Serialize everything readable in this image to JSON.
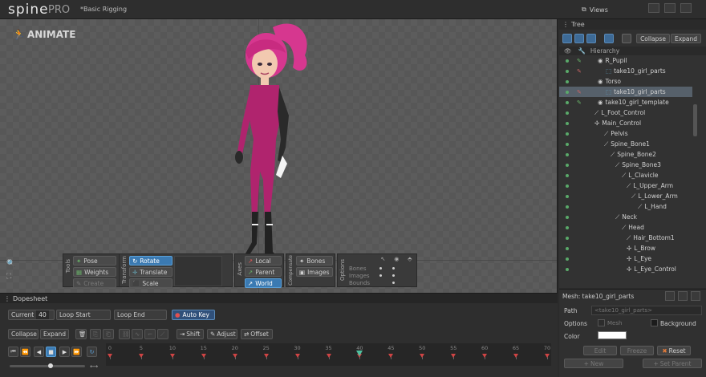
{
  "app": {
    "logo": "spine",
    "edition": "PRO",
    "project_title": "*Basic Rigging",
    "views_label": "Views"
  },
  "viewport": {
    "mode_label": "ANIMATE"
  },
  "tools": {
    "tools_group": "Tools",
    "pose": "Pose",
    "weights": "Weights",
    "create": "Create",
    "transform_group": "Transform",
    "rotate": "Rotate",
    "translate": "Translate",
    "scale": "Scale",
    "axes_group": "Axes",
    "local": "Local",
    "parent": "Parent",
    "world": "World",
    "compensate_group": "Compensate",
    "bones": "Bones",
    "images": "Images",
    "options_group": "Options",
    "opt_bones": "Bones",
    "opt_images": "Images",
    "opt_bounds": "Bounds"
  },
  "tree": {
    "tab_label": "Tree",
    "collapse": "Collapse",
    "expand": "Expand",
    "hierarchy": "Hierarchy",
    "rows": [
      {
        "label": "R_Pupil"
      },
      {
        "label": "take10_girl_parts"
      },
      {
        "label": "Torso"
      },
      {
        "label": "take10_girl_parts"
      },
      {
        "label": "take10_girl_template"
      },
      {
        "label": "L_Foot_Control"
      },
      {
        "label": "Main_Control"
      },
      {
        "label": "Pelvis"
      },
      {
        "label": "Spine_Bone1"
      },
      {
        "label": "Spine_Bone2"
      },
      {
        "label": "Spine_Bone3"
      },
      {
        "label": "L_Clavicle"
      },
      {
        "label": "L_Upper_Arm"
      },
      {
        "label": "L_Lower_Arm"
      },
      {
        "label": "L_Hand"
      },
      {
        "label": "Neck"
      },
      {
        "label": "Head"
      },
      {
        "label": "Hair_Bottom1"
      },
      {
        "label": "L_Brow"
      },
      {
        "label": "L_Eye"
      },
      {
        "label": "L_Eye_Control"
      }
    ]
  },
  "mesh": {
    "title": "Mesh: take10_girl_parts",
    "path_label": "Path",
    "path_value": "<take10_girl_parts>",
    "options_label": "Options",
    "mesh_check": "Mesh",
    "background_check": "Background",
    "color_label": "Color",
    "edit": "Edit",
    "freeze": "Freeze",
    "reset": "Reset",
    "new": "New",
    "set_parent": "Set Parent"
  },
  "dopesheet": {
    "title": "Dopesheet",
    "current_label": "Current",
    "current_value": "40",
    "loop_start": "Loop Start",
    "loop_end": "Loop End",
    "auto_key": "Auto Key",
    "collapse": "Collapse",
    "expand": "Expand",
    "shift": "Shift",
    "adjust": "Adjust",
    "offset": "Offset",
    "ticks": [
      "0",
      "5",
      "10",
      "15",
      "20",
      "25",
      "30",
      "35",
      "40",
      "45",
      "50",
      "55",
      "60",
      "65",
      "70"
    ],
    "current_frame": 40
  },
  "colors": {
    "accent": "#3b7ab2",
    "character_suit": "#b0246e",
    "hair": "#d6378f"
  }
}
